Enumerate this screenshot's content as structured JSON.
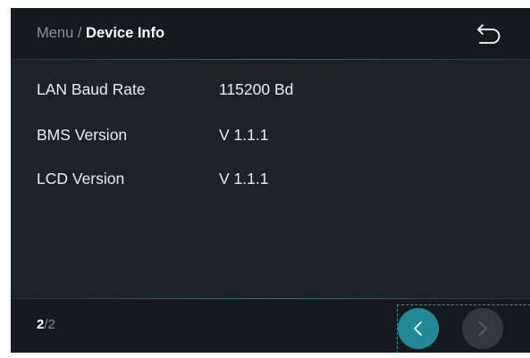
{
  "header": {
    "breadcrumb_parent": "Menu",
    "breadcrumb_separator": " / ",
    "breadcrumb_current": "Device Info",
    "back_icon": "undo-arrow-icon"
  },
  "info_rows": [
    {
      "label": "LAN Baud Rate",
      "value": "115200 Bd"
    },
    {
      "label": "BMS Version",
      "value": "V 1.1.1"
    },
    {
      "label": "LCD Version",
      "value": "V 1.1.1"
    }
  ],
  "footer": {
    "page_current": "2",
    "page_separator": "/",
    "page_total": "2",
    "prev_icon": "chevron-left-icon",
    "next_icon": "chevron-right-icon"
  },
  "colors": {
    "accent": "#1f8a96",
    "background": "#1d2227",
    "bar_background": "#161a1e",
    "text_primary": "#ffffff",
    "text_muted": "#8a9096"
  }
}
